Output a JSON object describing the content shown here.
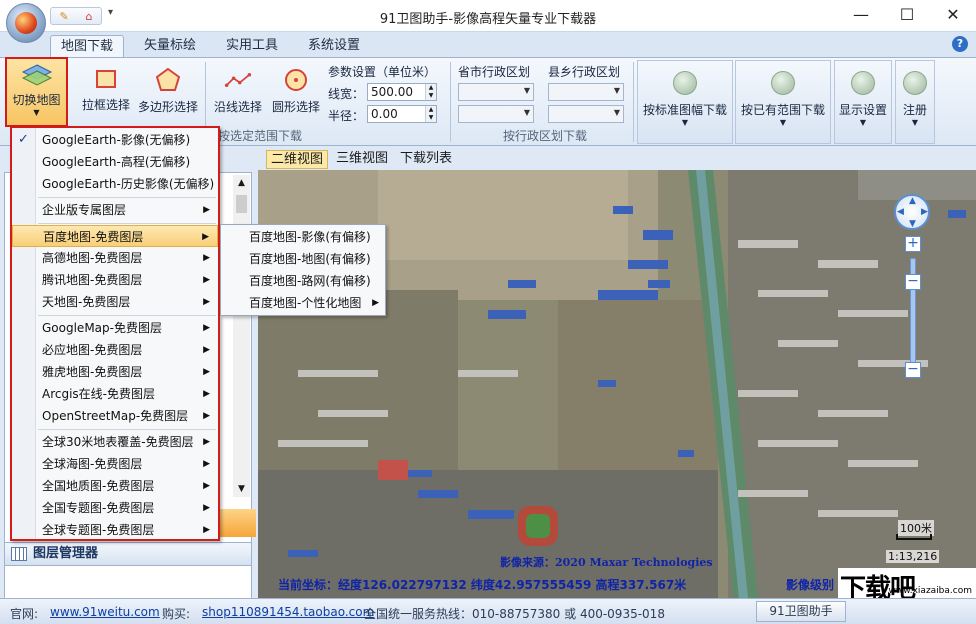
{
  "window": {
    "title": "91卫图助手-影像高程矢量专业下载器",
    "minimize": "—",
    "maximize": "☐",
    "close": "✕"
  },
  "quick_access": {
    "icon1": "✎",
    "icon2": "⌂",
    "more": "▾"
  },
  "tabs": [
    {
      "label": "地图下载",
      "active": true
    },
    {
      "label": "矢量标绘"
    },
    {
      "label": "实用工具"
    },
    {
      "label": "系统设置"
    }
  ],
  "help": "?",
  "ribbon": {
    "switch_map": "切换地图",
    "rect_select": "拉框选择",
    "polygon_select": "多边形选择",
    "line_select": "沿线选择",
    "circle_select": "圆形选择",
    "group_select_label": "按选定范围下载",
    "params_title": "参数设置（单位米）",
    "line_width_label": "线宽：",
    "line_width_value": "500.00",
    "radius_label": "半径：",
    "radius_value": "0.00",
    "province_label": "省市行政区划",
    "county_label": "县乡行政区划",
    "group_admin_label": "按行政区划下载",
    "std_sheet": "按标准图幅下载",
    "existing_range": "按已有范围下载",
    "display_settings": "显示设置",
    "register": "注册"
  },
  "layer_manager": "图层管理器",
  "map_tabs": [
    {
      "label": "二维视图",
      "active": true
    },
    {
      "label": "三维视图"
    },
    {
      "label": "下载列表"
    }
  ],
  "map": {
    "scale_label": "100米",
    "scale_ratio": "1:13,216",
    "image_source": "影像来源：2020 Maxar Technologies",
    "coords": "当前坐标：经度126.022797132 纬度42.957555459 高程337.567米",
    "image_level": "影像级别",
    "zoom_plus": "+",
    "zoom_minus": "−"
  },
  "watermark": {
    "big": "下载吧",
    "small": "www.xiazaiba.com"
  },
  "menu": {
    "items": [
      {
        "label": "GoogleEarth-影像(无偏移)",
        "checked": true
      },
      {
        "label": "GoogleEarth-高程(无偏移)"
      },
      {
        "label": "GoogleEarth-历史影像(无偏移)"
      },
      {
        "label": "企业版专属图层",
        "sub": true
      },
      {
        "label": "百度地图-免费图层",
        "sub": true,
        "highlight": true
      },
      {
        "label": "高德地图-免费图层",
        "sub": true
      },
      {
        "label": "腾讯地图-免费图层",
        "sub": true
      },
      {
        "label": "天地图-免费图层",
        "sub": true
      },
      {
        "label": "GoogleMap-免费图层",
        "sub": true
      },
      {
        "label": "必应地图-免费图层",
        "sub": true
      },
      {
        "label": "雅虎地图-免费图层",
        "sub": true
      },
      {
        "label": "Arcgis在线-免费图层",
        "sub": true
      },
      {
        "label": "OpenStreetMap-免费图层",
        "sub": true
      },
      {
        "label": "全球30米地表覆盖-免费图层",
        "sub": true
      },
      {
        "label": "全球海图-免费图层",
        "sub": true
      },
      {
        "label": "全国地质图-免费图层",
        "sub": true
      },
      {
        "label": "全国专题图-免费图层",
        "sub": true
      },
      {
        "label": "全球专题图-免费图层",
        "sub": true
      }
    ],
    "check_mark": "✓",
    "sub_arrow": "▶"
  },
  "submenu": {
    "items": [
      {
        "label": "百度地图-影像(有偏移)"
      },
      {
        "label": "百度地图-地图(有偏移)"
      },
      {
        "label": "百度地图-路网(有偏移)"
      },
      {
        "label": "百度地图-个性化地图",
        "sub": true
      }
    ]
  },
  "status": {
    "site_label": "官网:",
    "site_url": "www.91weitu.com",
    "buy_label": "购买:",
    "buy_url": "shop110891454.taobao.com",
    "hotline": "全国统一服务热线：010-88757380 或 400-0935-018",
    "app_label": "91卫图助手"
  },
  "colors": {
    "accent_red": "#d21b1b",
    "highlight": "#f8cf78",
    "ribbon": "#dde8f5"
  }
}
